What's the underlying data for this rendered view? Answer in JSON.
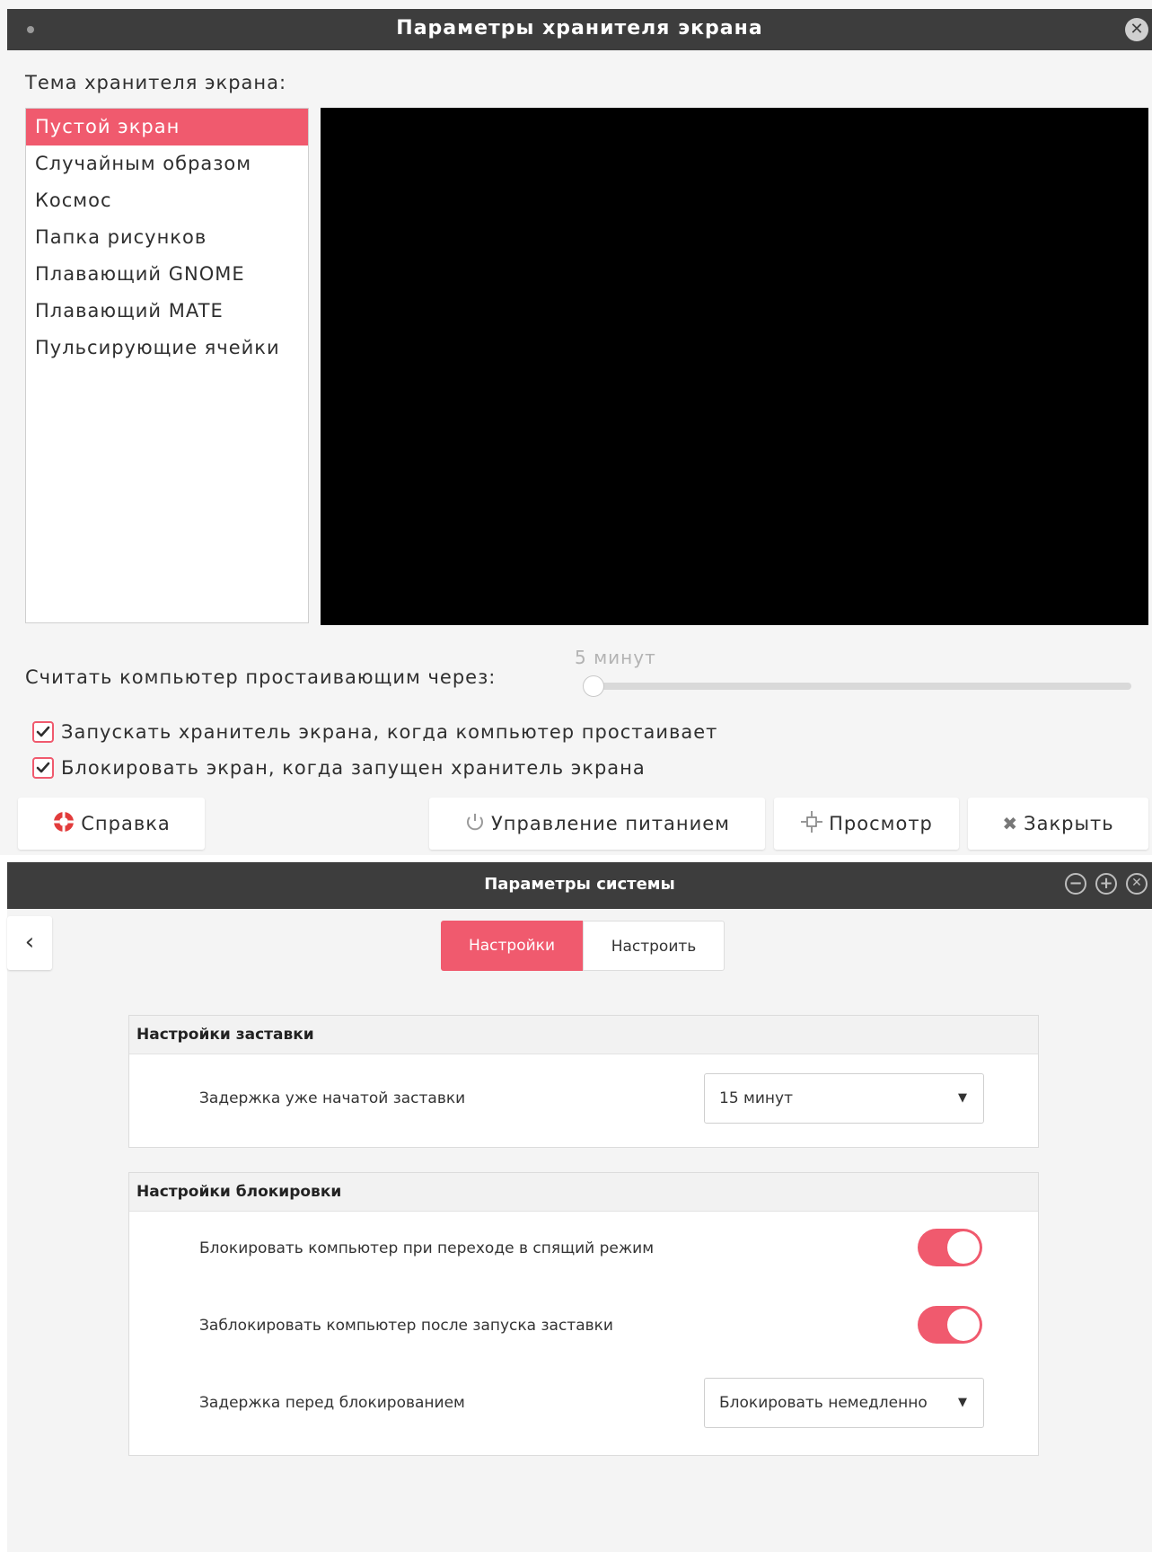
{
  "screensaver_window": {
    "title": "Параметры хранителя экрана",
    "theme_label": "Тема хранителя экрана:",
    "themes": [
      "Пустой экран",
      "Случайным образом",
      "Космос",
      "Папка рисунков",
      "Плавающий GNOME",
      "Плавающий MATE",
      "Пульсирующие ячейки"
    ],
    "selected_theme": "Пустой экран",
    "idle_label": "Считать компьютер простаивающим через:",
    "idle_value": "5 минут",
    "checkboxes": {
      "activate": {
        "label": "Запускать хранитель экрана, когда компьютер простаивает",
        "checked": true
      },
      "lock": {
        "label": "Блокировать экран, когда запущен хранитель экрана",
        "checked": true
      }
    },
    "buttons": {
      "help": "Справка",
      "power": "Управление питанием",
      "preview": "Просмотр",
      "close": "Закрыть"
    }
  },
  "system_window": {
    "title": "Параметры системы",
    "tabs": {
      "settings": "Настройки",
      "customize": "Настроить"
    },
    "screensaver_section": {
      "heading": "Настройки заставки",
      "delay_label": "Задержка уже начатой заставки",
      "delay_value": "15 минут"
    },
    "lock_section": {
      "heading": "Настройки блокировки",
      "lock_on_sleep_label": "Блокировать компьютер при переходе в спящий режим",
      "lock_on_sleep": true,
      "lock_after_screensaver_label": "Заблокировать компьютер после запуска заставки",
      "lock_after_screensaver": true,
      "lock_delay_label": "Задержка перед блокированием",
      "lock_delay_value": "Блокировать немедленно"
    }
  },
  "colors": {
    "accent": "#f05a6e",
    "titlebar": "#3d3d3d",
    "preview": "#000000"
  },
  "icons": [
    "help-icon",
    "power-icon",
    "preview-icon",
    "close-icon",
    "back-icon",
    "dropdown-arrow-icon",
    "minimize-icon",
    "maximize-icon"
  ]
}
